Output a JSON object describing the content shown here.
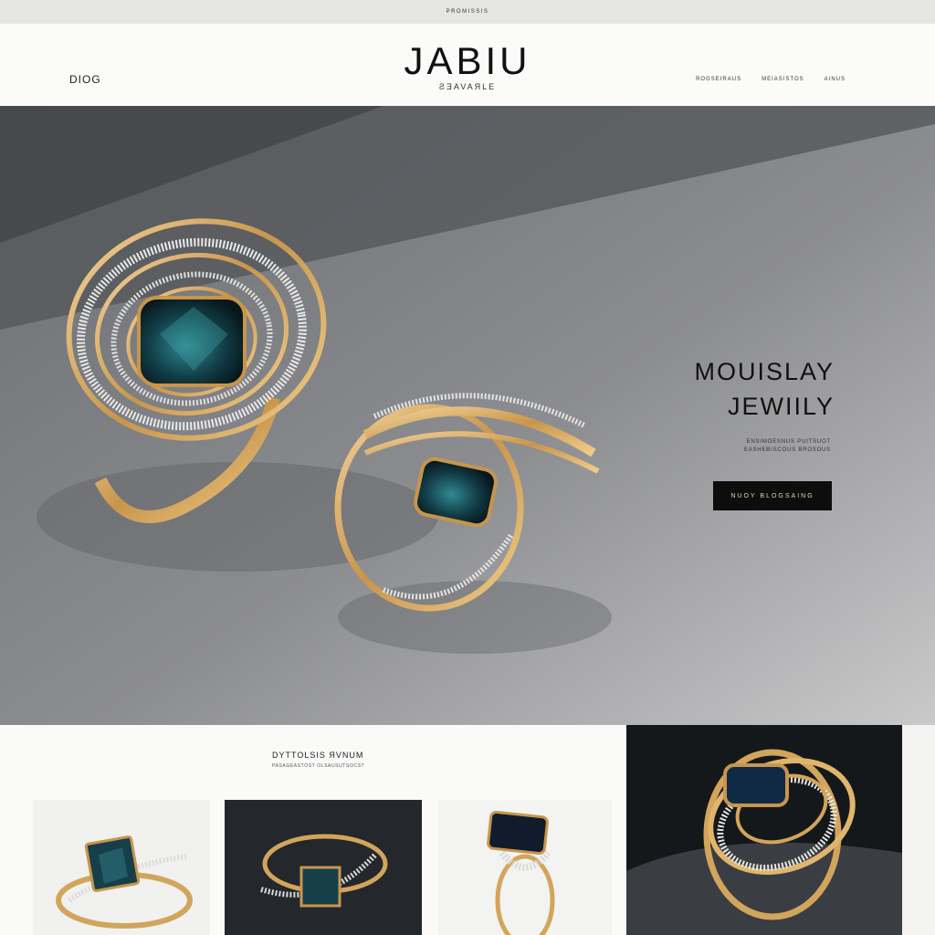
{
  "topbar": {
    "text": "PROMISSIS"
  },
  "header": {
    "left_link": "DIOG",
    "brand": "JABIU",
    "brand_sub": "ƧƎAVAЯLE",
    "nav": [
      "ROGSEIRAUS",
      "MEIASISTOS",
      "AINUS"
    ]
  },
  "hero": {
    "title_line1": "MOUISLAY",
    "title_line2": "JEWIILY",
    "desc_line1": "ENSIMOESNUS PUITSUOT",
    "desc_line2": "EASHEBISCOUS BROSOUS",
    "cta": "NUOY BLOGSAING"
  },
  "section": {
    "title": "DYTTOLSIS ЯVNUM",
    "subtitle": "PASAGEASTOST OLSAUSUTSOCST"
  },
  "icons": {
    "hero_ring_large": "gold-spiral-ring-icon",
    "hero_ring_small": "gold-twist-ring-icon"
  },
  "colors": {
    "gold": "#d2a55c",
    "gem": "#163f4a",
    "hero_bg": "#8a8b8d",
    "cta_bg": "#0d0d0d"
  }
}
